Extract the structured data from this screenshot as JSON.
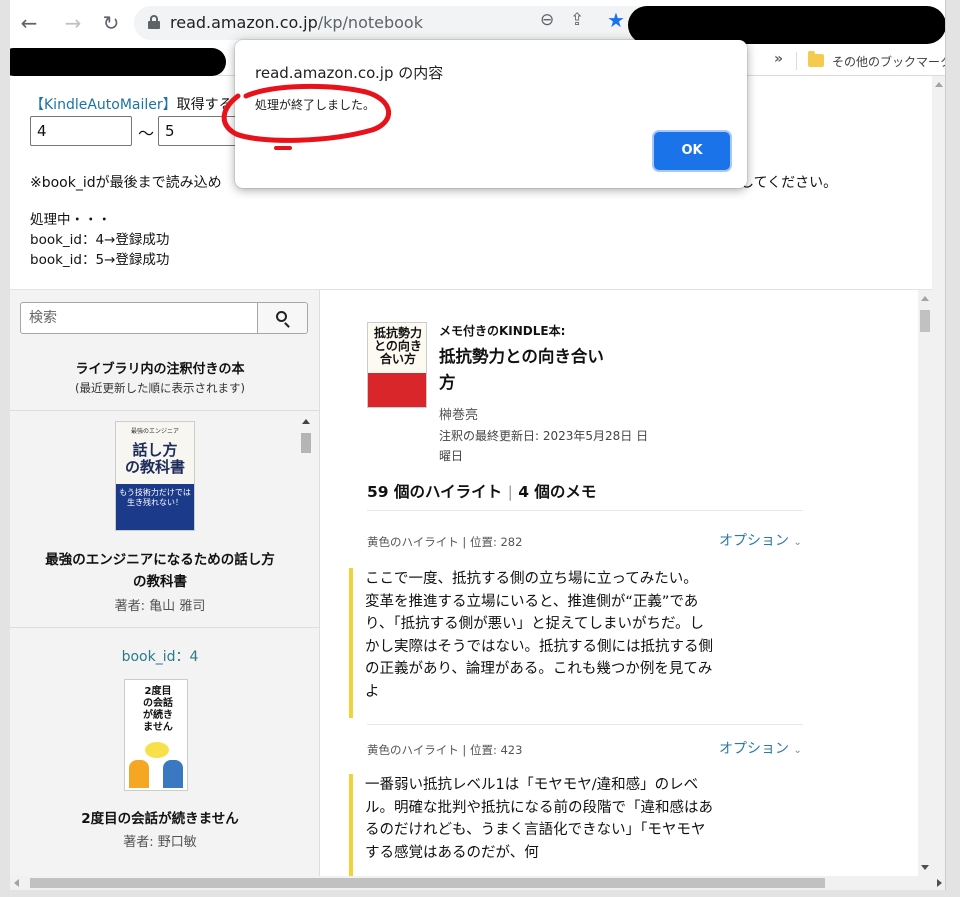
{
  "browser": {
    "url_domain": "read.amazon.co.jp",
    "url_path": "/kp/notebook",
    "back_glyph": "←",
    "forward_glyph": "→",
    "reload_glyph": "↻",
    "zoom_glyph": "⊖",
    "share_glyph": "⇪",
    "star_glyph": "★",
    "star_color": "#1a73e8"
  },
  "bookmarks": {
    "chevron": "»",
    "other_label": "その他のブックマーク"
  },
  "tool": {
    "title_name": "【KindleAutoMailer】",
    "title_rest": "取得する",
    "from_value": "4",
    "to_value": "5",
    "tilde": "〜",
    "note": "※book_idが最後まで読み込め",
    "note_end": "してください。",
    "log": [
      "処理中・・・",
      "book_id：4→登録成功",
      "book_id：5→登録成功"
    ]
  },
  "dialog": {
    "title": "read.amazon.co.jp の内容",
    "message": "処理が終了しました。",
    "ok_label": "OK",
    "accent": "#1a73e8"
  },
  "library": {
    "search_placeholder": "検索",
    "title": "ライブラリ内の注釈付きの本",
    "subtitle": "(最近更新した順に表示されます)",
    "books": [
      {
        "cover_top": "最強のエンジニア",
        "cover_main": "話し方\nの教科書",
        "cover_band": "もう技術力だけでは\n生き残れない！",
        "title": "最強のエンジニアになるための話し方の教科書",
        "author": "著者: 亀山 雅司"
      },
      {
        "book_id_label": "book_id：4",
        "cover_text": "2度目の会話が続きません",
        "title": "2度目の会話が続きません",
        "author": "著者: 野口敏"
      }
    ]
  },
  "notebook": {
    "cover_title": "抵抗勢力との向き合い方",
    "label": "メモ付きのKINDLE本:",
    "title": "抵抗勢力との向き合い方",
    "author": "榊巻亮",
    "updated": "注釈の最終更新日: 2023年5月28日 日曜日",
    "counts_highlights": "59 個のハイライト",
    "counts_sep": "|",
    "counts_notes": "4 個のメモ",
    "highlight_color": "#f2d23b",
    "highlights": [
      {
        "meta": "黄色のハイライト | 位置: 282",
        "options": "オプション",
        "text": "ここで一度、抵抗する側の立ち場に立ってみたい。 変革を推進する立場にいると、推進側が“正義”であり、「抵抗する側が悪い」と捉えてしまいがちだ。しかし実際はそうではない。抵抗する側には抵抗する側の正義があり、論理がある。これも幾つか例を見てみよ"
      },
      {
        "meta": "黄色のハイライト | 位置: 423",
        "options": "オプション",
        "text": "一番弱い抵抗レベル1は「モヤモヤ/違和感」のレベル。明確な批判や抵抗になる前の段階で「違和感はあるのだけれども、うまく言語化できない」「モヤモヤする感覚はあるのだが、何"
      }
    ]
  }
}
